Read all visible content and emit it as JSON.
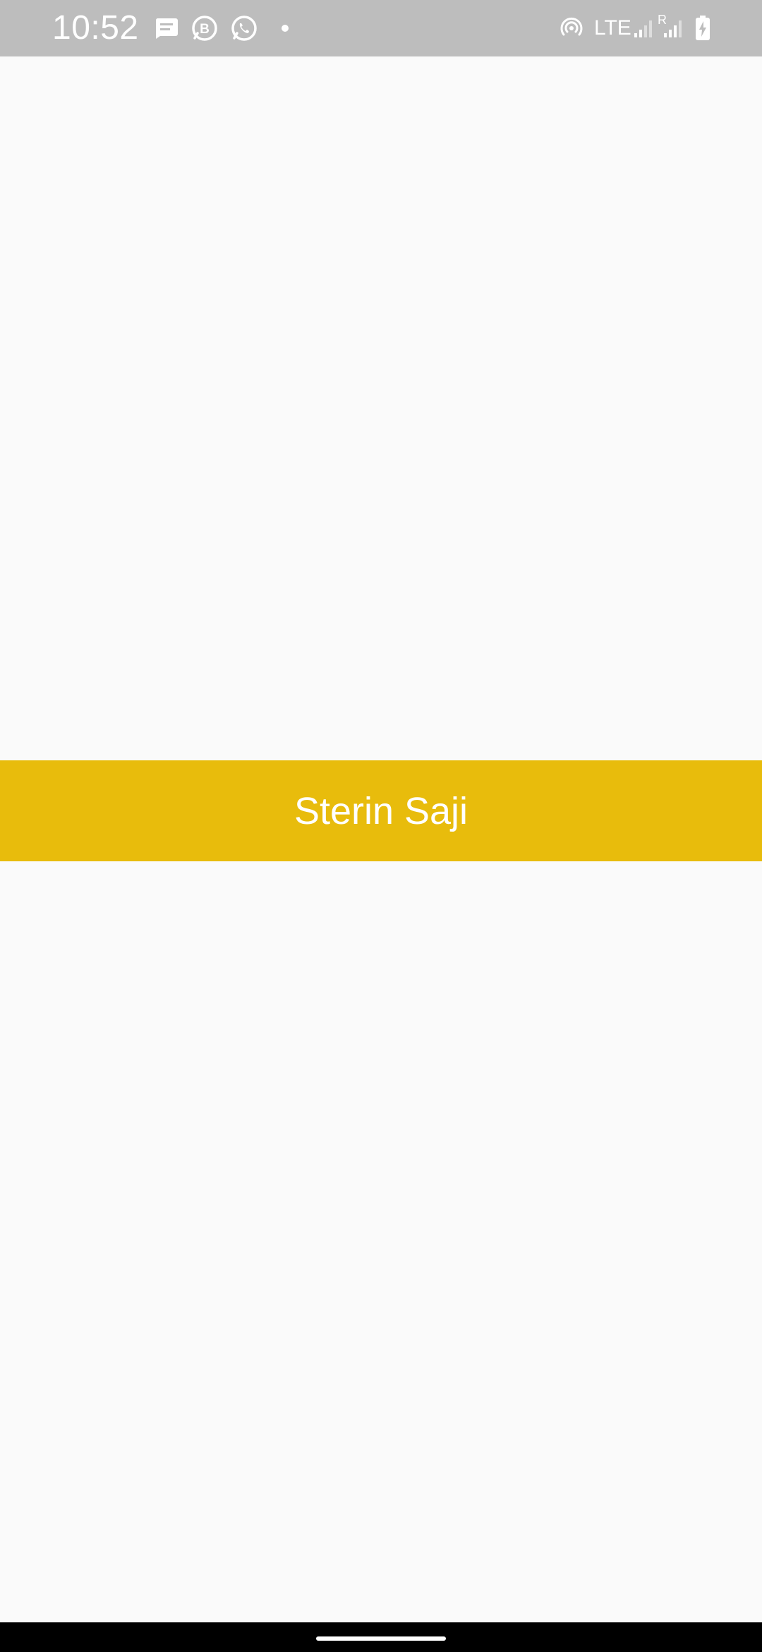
{
  "status_bar": {
    "time": "10:52",
    "network_label": "LTE",
    "roaming_label": "R",
    "background": "#bdbdbd",
    "notification_icons": [
      "messages-icon",
      "whatsapp-business-icon",
      "whatsapp-icon",
      "notification-dot-icon"
    ],
    "system_icons": [
      "hotspot-icon",
      "signal-icon",
      "roaming-signal-icon",
      "battery-charging-icon"
    ]
  },
  "main": {
    "name": "Sterin Saji",
    "banner_color": "#e8bc0c",
    "background": "#fafafa"
  },
  "nav_bar": {
    "background": "#000000"
  }
}
